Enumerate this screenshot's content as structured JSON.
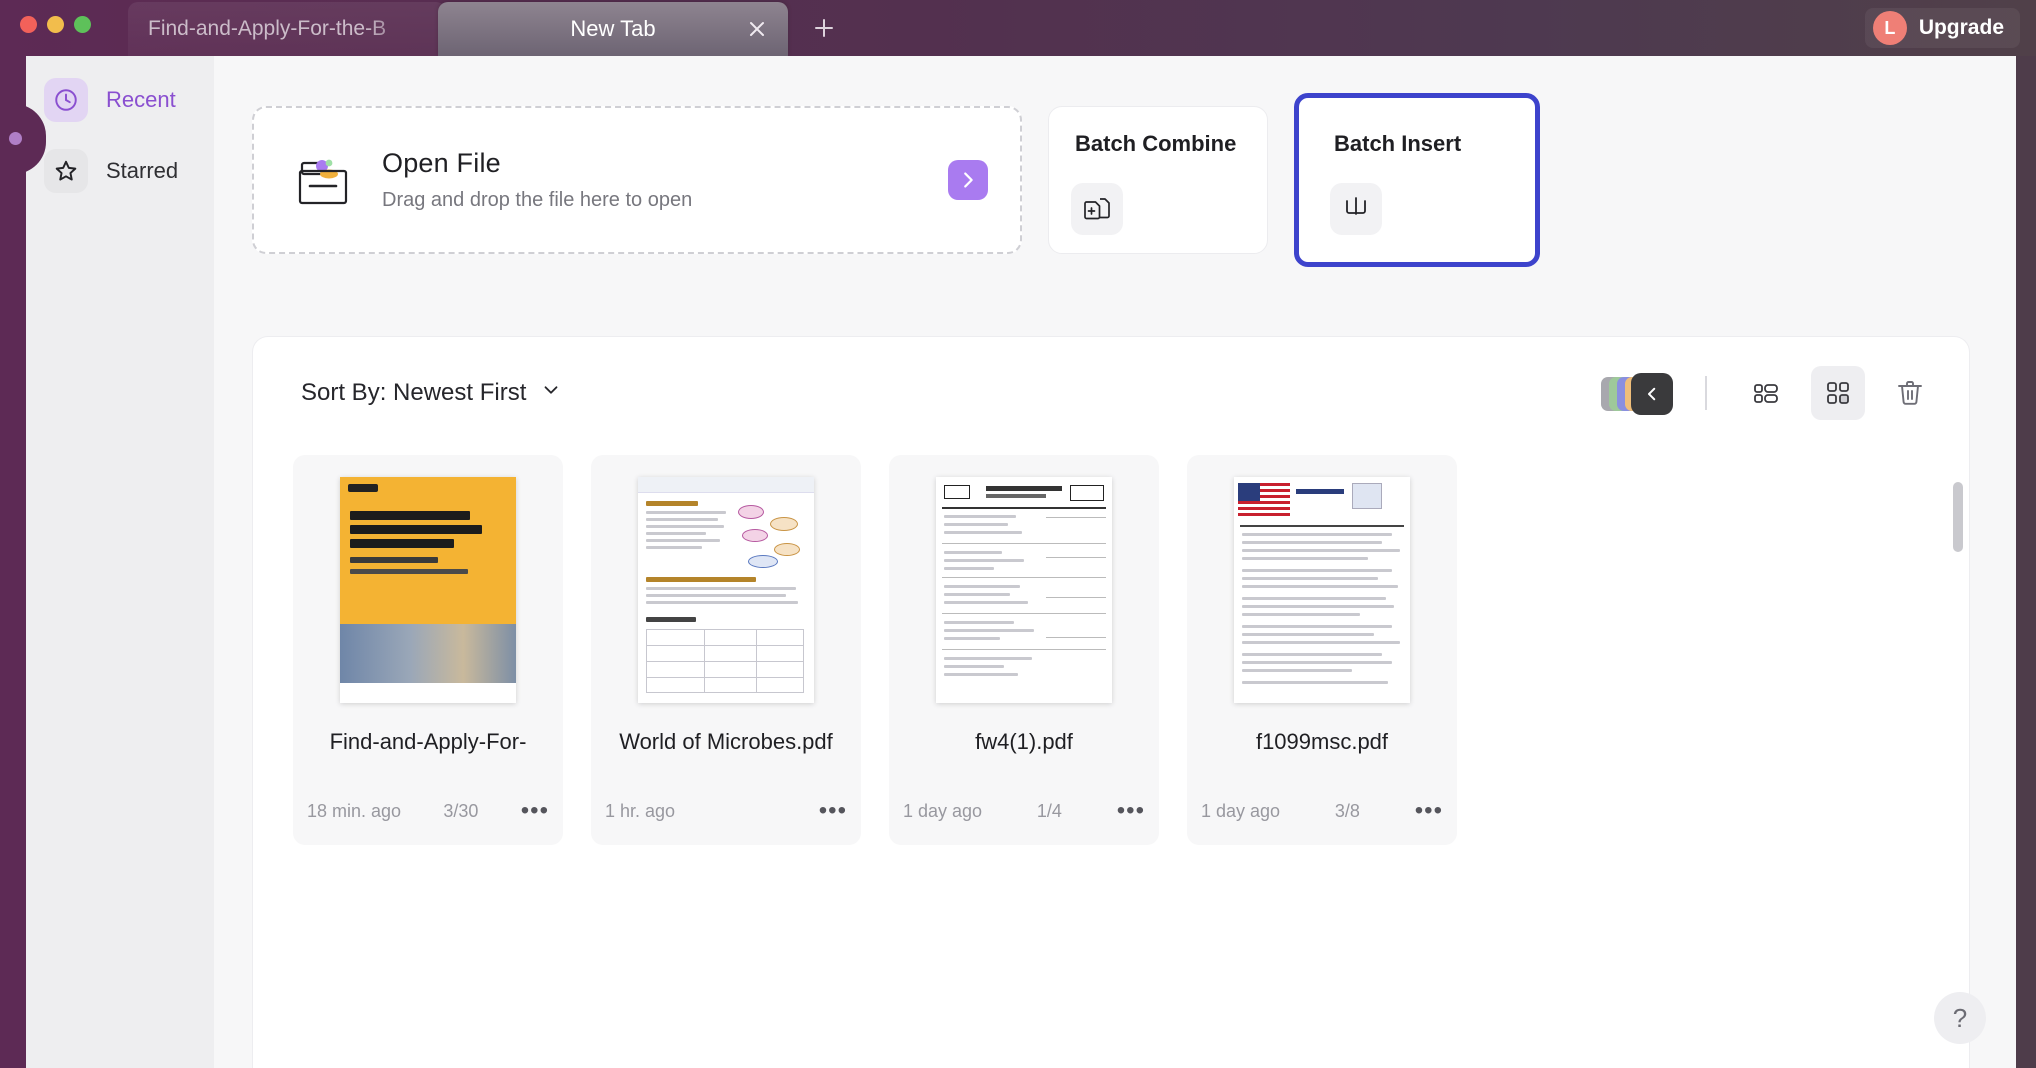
{
  "window": {
    "traffic_lights": [
      "close",
      "minimize",
      "maximize"
    ],
    "colors": {
      "titlebar_left": "#5d2a55",
      "accent_purple": "#8a4fd0",
      "highlight_blue": "#3d43cc",
      "arrow_button": "#a97bf0"
    }
  },
  "tabs": [
    {
      "title": "Find-and-Apply-For-the-B",
      "active": false
    },
    {
      "title": "New Tab",
      "active": true,
      "close_icon": "close-icon"
    }
  ],
  "new_tab_button": {
    "icon": "plus-icon",
    "label": "+"
  },
  "account": {
    "avatar_initial": "L",
    "upgrade_label": "Upgrade"
  },
  "sidebar": {
    "items": [
      {
        "label": "Recent",
        "icon": "clock-icon",
        "active": true
      },
      {
        "label": "Starred",
        "icon": "star-icon",
        "active": false
      }
    ]
  },
  "open_file": {
    "title": "Open File",
    "subtitle": "Drag and drop the file here to open",
    "icon": "open-folder-icon",
    "arrow_icon": "chevron-right-icon"
  },
  "tools": [
    {
      "title": "Batch Combine",
      "icon": "combine-files-icon",
      "highlighted": false
    },
    {
      "title": "Batch Insert",
      "icon": "insert-pages-icon",
      "highlighted": true
    }
  ],
  "toolbar": {
    "sort_label": "Sort By: Newest First",
    "sort_chevron": "chevron-down-icon",
    "stack_collapse_icon": "chevron-left-icon",
    "stack_colors": [
      "#a8a8ae",
      "#9ec99a",
      "#8a8fe0",
      "#efbe7a",
      "#e8a36f"
    ],
    "list_view_icon": "list-view-icon",
    "grid_view_icon": "grid-view-icon",
    "grid_view_active": true,
    "trash_icon": "trash-icon"
  },
  "files": [
    {
      "name": "Find-and-Apply-For-",
      "time": "18 min. ago",
      "pages": "3/30",
      "menu_icon": "more-options-icon",
      "thumb": "cover-orange"
    },
    {
      "name": "World of Microbes.pdf",
      "time": "1 hr. ago",
      "pages": "",
      "menu_icon": "more-options-icon",
      "thumb": "doc-diagram"
    },
    {
      "name": "fw4(1).pdf",
      "time": "1 day ago",
      "pages": "1/4",
      "menu_icon": "more-options-icon",
      "thumb": "form-w4"
    },
    {
      "name": "f1099msc.pdf",
      "time": "1 day ago",
      "pages": "3/8",
      "menu_icon": "more-options-icon",
      "thumb": "form-1099"
    }
  ],
  "help": {
    "label": "?",
    "icon": "help-icon"
  }
}
